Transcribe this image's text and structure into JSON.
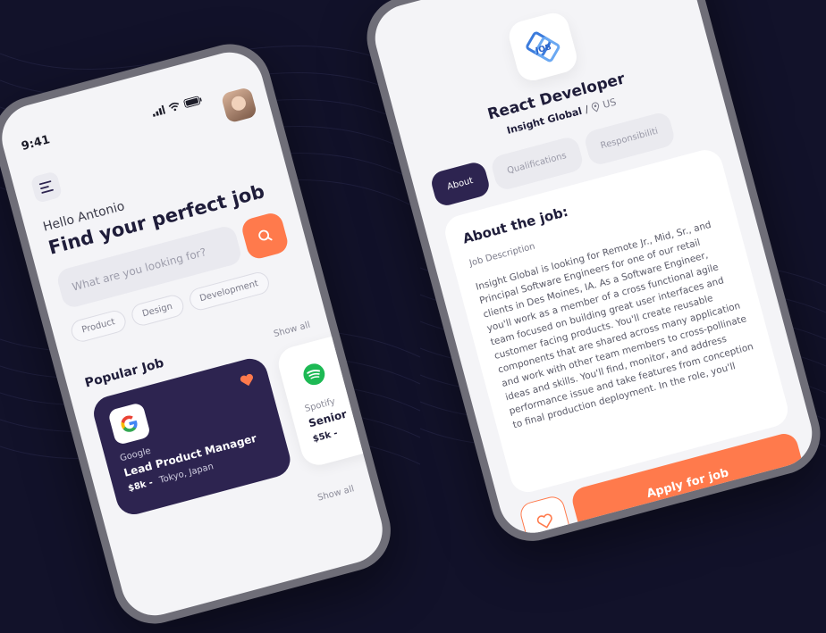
{
  "colors": {
    "background": "#12122a",
    "accent": "#ff7a4c",
    "primary_dark": "#2d2450",
    "phone_frame": "#6f6e78"
  },
  "home": {
    "time": "9:41",
    "status_icons": [
      "signal-icon",
      "wifi-icon",
      "battery-icon"
    ],
    "greeting": "Hello Antonio",
    "headline": "Find your perfect job",
    "search_placeholder": "What are you looking for?",
    "categories": [
      "Product",
      "Design",
      "Development"
    ],
    "show_all_label": "Show all",
    "popular_title": "Popular Job",
    "popular_jobs": [
      {
        "company": "Google",
        "role": "Lead Product Manager",
        "salary": "$8k -",
        "location": "Tokyo, Japan",
        "logo": "google-logo-icon"
      },
      {
        "company": "Spotify",
        "role": "Senior",
        "salary": "$5k -",
        "location": "",
        "logo": "spotify-logo-icon"
      }
    ],
    "bottom_show_all": "Show all"
  },
  "detail": {
    "logo_text": "JOB",
    "title": "React Developer",
    "company": "Insight Global",
    "separator": "/",
    "location": "US",
    "tabs": [
      "About",
      "Qualifications",
      "Responsibiliti"
    ],
    "active_tab": "About",
    "about_title": "About the job:",
    "description_label": "Job Description",
    "description": "Insight Global is looking for Remote Jr., Mid, Sr., and Principal Software Engineers for one of our retail clients in Des Moines, IA. As a Software Engineer, you'll work as a member of a cross functional agile team focused on building great user interfaces and customer facing products. You'll create reusable components that are shared across many application and work with other team members to cross-pollinate ideas and skills. You'll find, monitor, and address performance issue and take features from conception to final production deployment. In the role, you'll",
    "apply_label": "Apply for job"
  }
}
